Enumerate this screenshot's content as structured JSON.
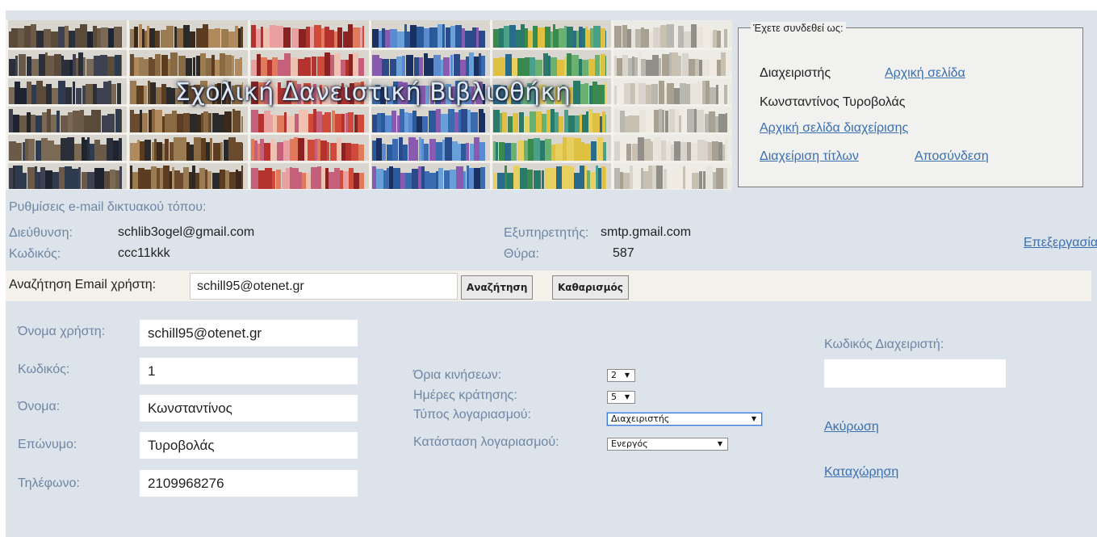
{
  "banner": {
    "title": "Σχολική Δανειστική Βιβλιοθήκη"
  },
  "login": {
    "legend": "Έχετε συνδεθεί ως:",
    "role": "Διαχειριστής",
    "home_link": "Αρχική σελίδα",
    "user_name": "Κωνσταντίνος Τυροβολάς",
    "admin_home_link": "Αρχική σελίδα διαχείρισης",
    "titles_link": "Διαχείριση τίτλων",
    "logout_link": "Αποσύνδεση"
  },
  "email_settings": {
    "heading": "Ρυθμίσεις e-mail δικτυακού τόπου:",
    "address_label": "Διεύθυνση:",
    "address_value": "schlib3ogel@gmail.com",
    "password_label": "Κωδικός:",
    "password_value": "ccc11kkk",
    "server_label": "Εξυπηρετητής:",
    "server_value": "smtp.gmail.com",
    "port_label": "Θύρα:",
    "port_value": "587",
    "edit_link": "Επεξεργασία"
  },
  "search": {
    "label": "Αναζήτηση Email χρήστη:",
    "value": "schill95@otenet.gr",
    "search_button": "Αναζήτηση",
    "clear_button": "Καθαρισμός"
  },
  "user_form": {
    "username_label": "Όνομα χρήστη:",
    "username_value": "schill95@otenet.gr",
    "password_label": "Κωδικός:",
    "password_value": "1",
    "firstname_label": "Όνομα:",
    "firstname_value": "Κωνσταντίνος",
    "lastname_label": "Επώνυμο:",
    "lastname_value": "Τυροβολάς",
    "phone_label": "Τηλέφωνο:",
    "phone_value": "2109968276"
  },
  "account": {
    "limits_label": "Όρια κινήσεων:",
    "limits_value": "2",
    "days_label": "Ημέρες κράτησης:",
    "days_value": "5",
    "type_label": "Τύπος λογαριασμού:",
    "type_value": "Διαχειριστής",
    "status_label": "Κατάσταση λογαριασμού:",
    "status_value": "Ενεργός"
  },
  "admin": {
    "admin_code_label": "Κωδικός Διαχειριστή:",
    "admin_code_value": "",
    "cancel_link": "Ακύρωση",
    "submit_link": "Καταχώρηση"
  }
}
